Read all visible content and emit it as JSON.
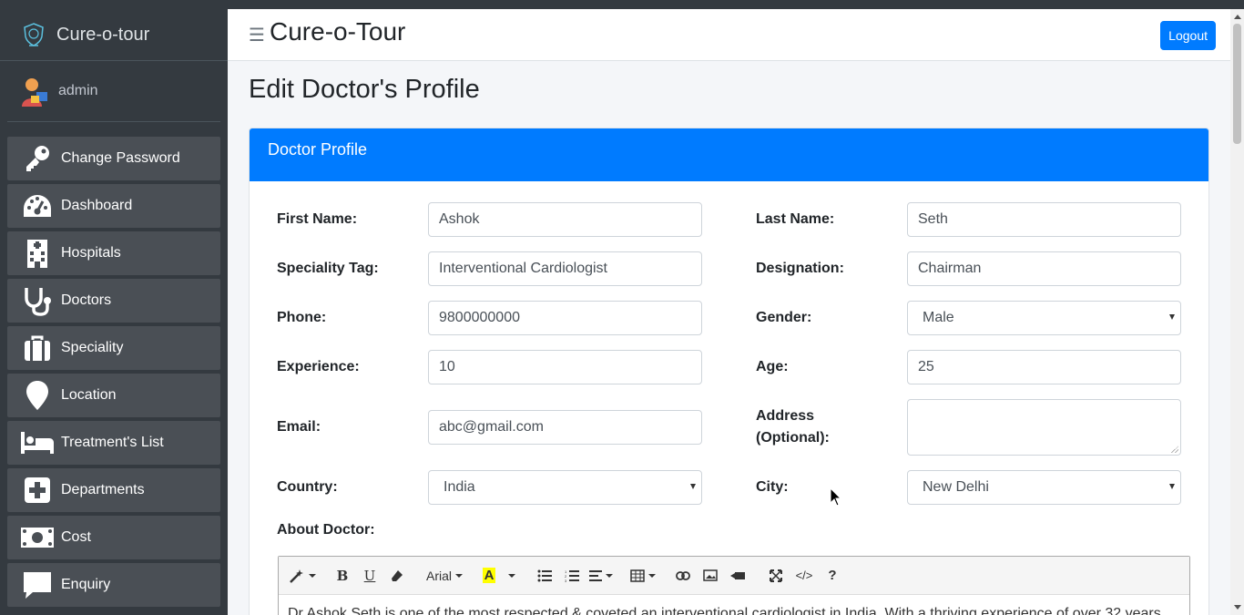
{
  "app": {
    "brand": "Cure-o-tour",
    "header_title": "Cure-o-Tour",
    "logout_label": "Logout"
  },
  "user": {
    "name": "admin"
  },
  "sidebar": {
    "items": [
      {
        "label": "Change Password",
        "icon": "key-icon"
      },
      {
        "label": "Dashboard",
        "icon": "tachometer-icon"
      },
      {
        "label": "Hospitals",
        "icon": "hospital-icon"
      },
      {
        "label": "Doctors",
        "icon": "stethoscope-icon"
      },
      {
        "label": "Speciality",
        "icon": "briefcase-icon"
      },
      {
        "label": "Location",
        "icon": "map-pin-icon"
      },
      {
        "label": "Treatment's List",
        "icon": "bed-icon"
      },
      {
        "label": "Departments",
        "icon": "plus-square-icon"
      },
      {
        "label": "Cost",
        "icon": "money-icon"
      },
      {
        "label": "Enquiry",
        "icon": "comment-icon"
      }
    ]
  },
  "page": {
    "title": "Edit Doctor's Profile",
    "card_title": "Doctor Profile"
  },
  "form": {
    "first_name": {
      "label": "First Name:",
      "value": "Ashok"
    },
    "last_name": {
      "label": "Last Name:",
      "value": "Seth"
    },
    "speciality_tag": {
      "label": "Speciality Tag:",
      "value": "Interventional Cardiologist"
    },
    "designation": {
      "label": "Designation:",
      "value": "Chairman"
    },
    "phone": {
      "label": "Phone:",
      "value": "9800000000"
    },
    "gender": {
      "label": "Gender:",
      "value": "Male"
    },
    "experience": {
      "label": "Experience:",
      "value": "10"
    },
    "age": {
      "label": "Age:",
      "value": "25"
    },
    "email": {
      "label": "Email:",
      "value": "abc@gmail.com"
    },
    "address": {
      "label_line1": "Address",
      "label_line2": "(Optional):",
      "value": ""
    },
    "country": {
      "label": "Country:",
      "value": "India"
    },
    "city": {
      "label": "City:",
      "value": "New Delhi"
    },
    "about": {
      "label": "About Doctor:",
      "font": "Arial",
      "text": "Dr Ashok Seth is one of the most respected & coveted an interventional cardiologist in India. With a thriving experience of over 32 years"
    }
  },
  "colors": {
    "primary": "#007bff",
    "sidebar_bg": "#343a40",
    "nav_item_bg": "#4a4f55",
    "highlight": "#ffff00"
  }
}
